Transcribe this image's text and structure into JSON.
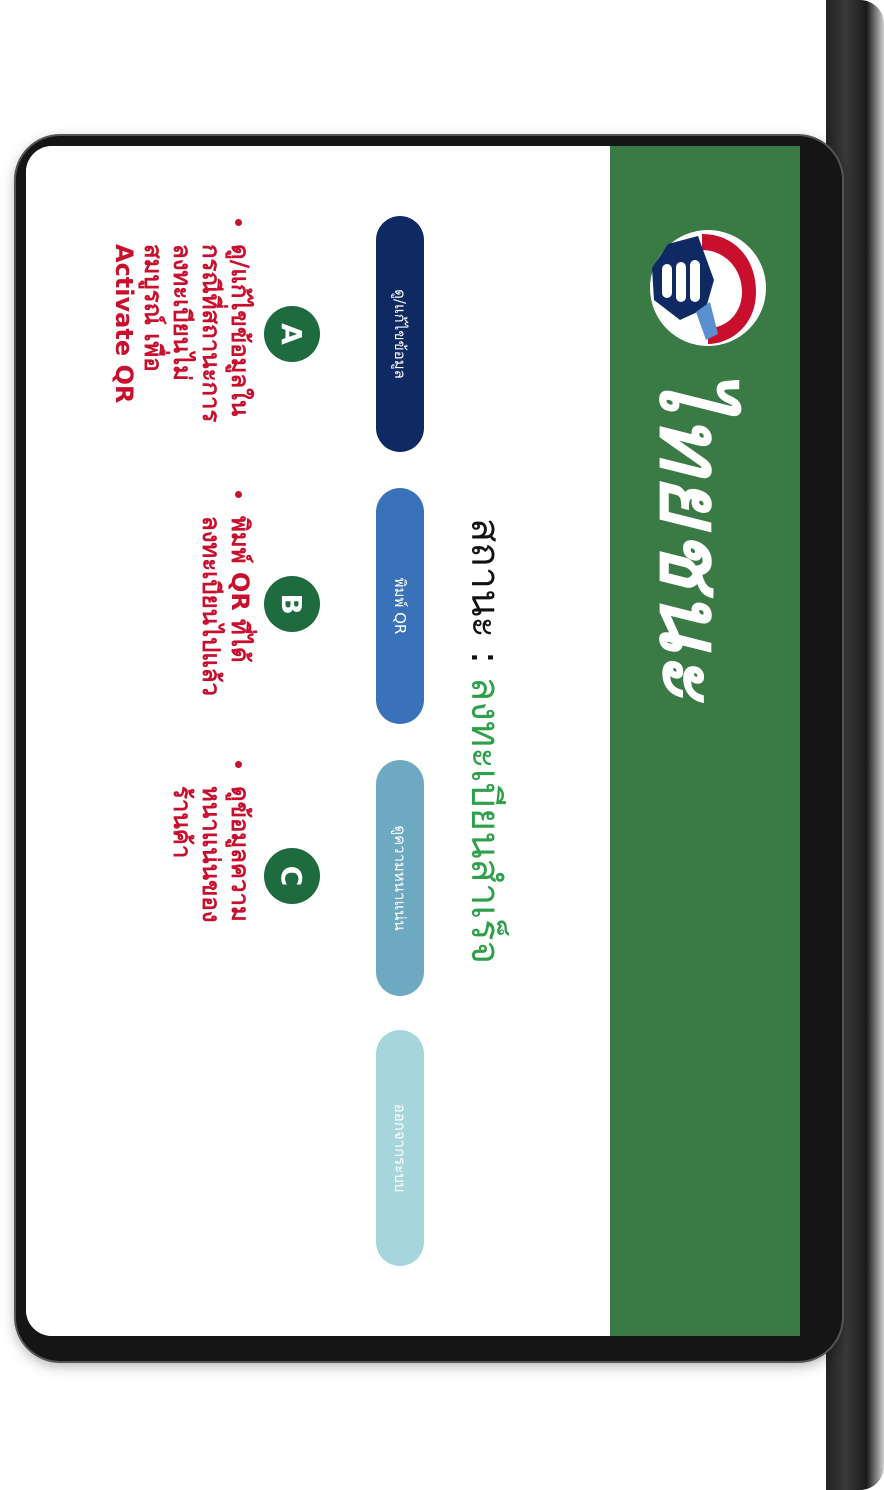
{
  "header": {
    "brand": "ไทยชนะ"
  },
  "status": {
    "label": "สถานะ : ",
    "value": "ลงทะเบียนสำเร็จ"
  },
  "buttons": {
    "view_edit": "ดู/แก้ไขข้อมูล",
    "print_qr": "พิมพ์ QR",
    "density": "ดูความหนาแน่น",
    "logout": "ออกจากระบบ"
  },
  "annotations": [
    {
      "marker": "A",
      "lines": [
        "ดู/แก้ไขข้อมูลใน",
        "กรณีที่สถานะการ",
        "ลงทะเบียนไม่",
        "สมบูรณ์ เพื่อ",
        "Activate QR"
      ]
    },
    {
      "marker": "B",
      "lines": [
        "พิมพ์ QR ที่ได้",
        "ลงทะเบียนไปแล้ว"
      ]
    },
    {
      "marker": "C",
      "lines": [
        "ดูข้อมูลความ",
        "หนาแน่นของ",
        "ร้านค้า"
      ]
    }
  ],
  "colors": {
    "header_green": "#3a7a44",
    "status_green": "#2ea04a",
    "marker_green": "#1d6b3e",
    "note_red": "#c8102e",
    "btn_dark_navy": "#0f2a63",
    "btn_blue": "#3a72b9",
    "btn_steel": "#6ea9c2",
    "btn_light_teal": "#a6d6db"
  },
  "icons": {
    "logo": "handshake-fist-logo"
  }
}
